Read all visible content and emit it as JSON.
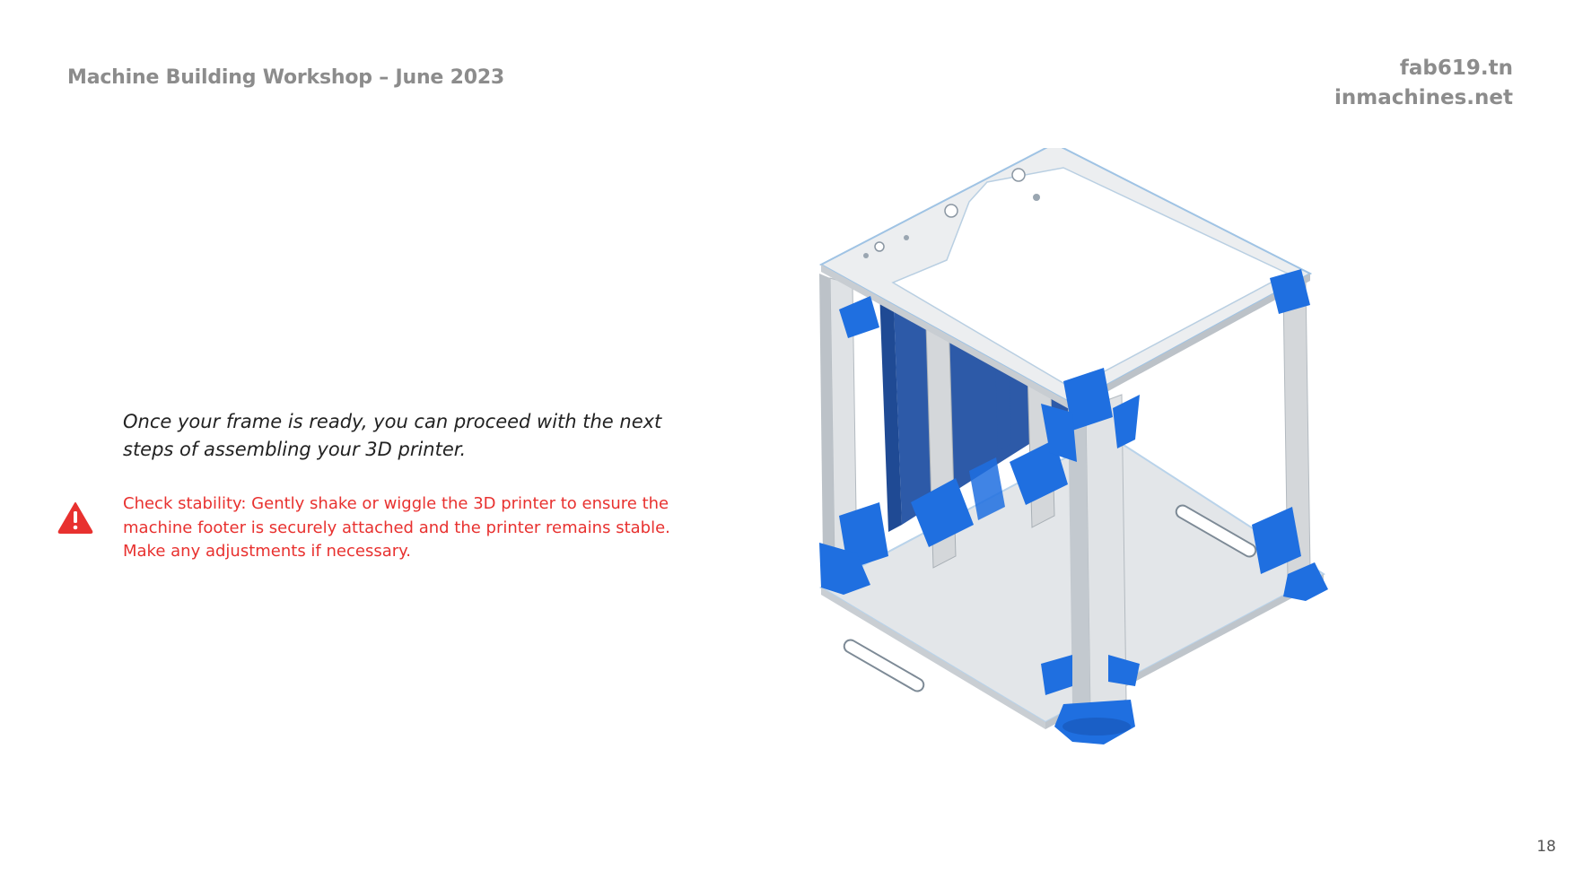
{
  "header": {
    "title": "Machine Building Workshop – June 2023",
    "brand_line_1": "fab619.tn",
    "brand_line_2": "inmachines.net"
  },
  "content": {
    "intro": "Once your frame is ready, you can proceed with the next steps of assembling your 3D printer.",
    "warning": "Check stability: Gently shake or wiggle the 3D printer to ensure the machine footer is securely attached and the printer remains stable. Make any adjustments if necessary.",
    "warning_icon": "warning-triangle-icon"
  },
  "illustration": {
    "subject": "3d-printer-frame-render",
    "colors": {
      "plate": "#e8ebee",
      "extrusion": "#d4d7da",
      "printed_part": "#1f6fe0",
      "panel": "#2d5aa8"
    }
  },
  "footer": {
    "page_number": "18"
  },
  "colors": {
    "heading_gray": "#8c8c8c",
    "warning_red": "#e8312f",
    "body_text": "#222222"
  }
}
